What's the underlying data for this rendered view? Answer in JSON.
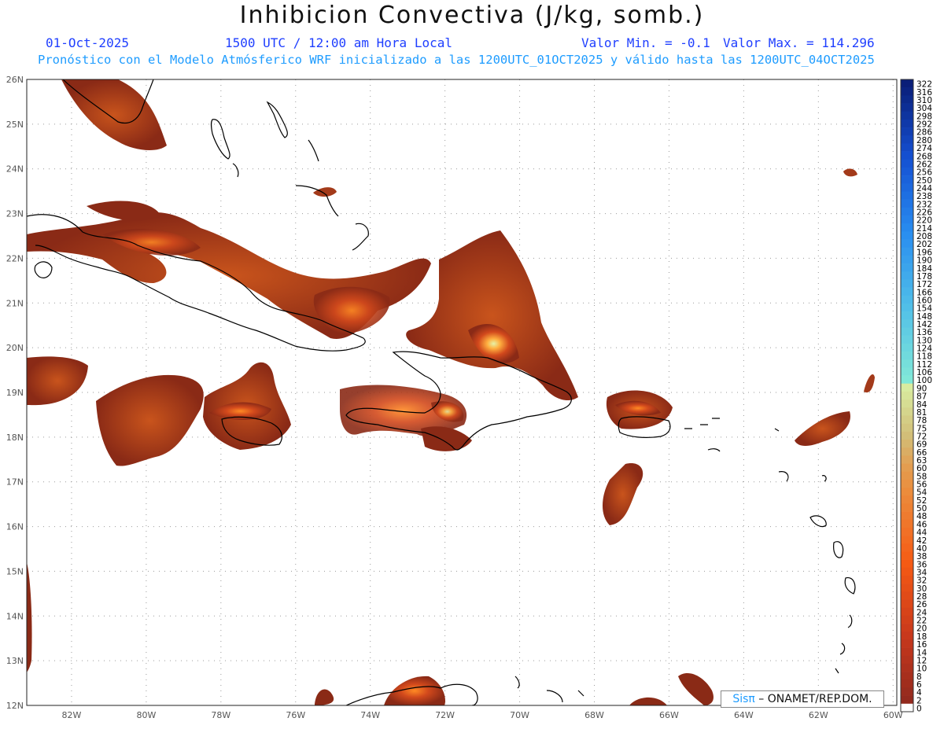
{
  "header": {
    "title": "Inhibicion Convectiva (J/kg, somb.)",
    "date": "01-Oct-2025",
    "time": "1500 UTC / 12:00 am Hora Local",
    "min_label": "Valor Min. = -0.1",
    "max_label": "Valor Max. = 114.296",
    "subtitle": "Pronóstico con el Modelo Atmósferico WRF inicializado a las 1200UTC_01OCT2025 y válido hasta las  1200UTC_04OCT2025"
  },
  "map": {
    "lat_labels": [
      "26N",
      "25N",
      "24N",
      "23N",
      "22N",
      "21N",
      "20N",
      "19N",
      "18N",
      "17N",
      "16N",
      "15N",
      "14N",
      "13N",
      "12N"
    ],
    "lon_labels": [
      "82W",
      "80W",
      "78W",
      "76W",
      "74W",
      "72W",
      "70W",
      "68W",
      "66W",
      "64W",
      "62W",
      "60W"
    ],
    "lat_range": [
      12,
      26
    ],
    "lon_range": [
      -83.2,
      -59.9
    ],
    "grid": true,
    "grid_style": "dotted",
    "field_colors": {
      "low": "#8a2a16",
      "mid": "#c6401a",
      "high": "#ff7a1e",
      "peak": "#d6eea0"
    }
  },
  "colorbar": {
    "labels": [
      "322",
      "316",
      "310",
      "304",
      "298",
      "292",
      "286",
      "280",
      "274",
      "268",
      "262",
      "256",
      "250",
      "244",
      "238",
      "232",
      "226",
      "220",
      "214",
      "208",
      "202",
      "196",
      "190",
      "184",
      "178",
      "172",
      "166",
      "160",
      "154",
      "148",
      "142",
      "136",
      "130",
      "124",
      "118",
      "112",
      "106",
      "100",
      "90",
      "87",
      "84",
      "81",
      "78",
      "75",
      "72",
      "69",
      "66",
      "63",
      "60",
      "58",
      "56",
      "54",
      "52",
      "50",
      "48",
      "46",
      "44",
      "42",
      "40",
      "38",
      "36",
      "34",
      "32",
      "30",
      "28",
      "26",
      "24",
      "22",
      "20",
      "18",
      "16",
      "14",
      "12",
      "10",
      "8",
      "6",
      "4",
      "2",
      "0"
    ]
  },
  "credit": {
    "logo": "Sisπ",
    "text": " – ONAMET/REP.DOM."
  }
}
